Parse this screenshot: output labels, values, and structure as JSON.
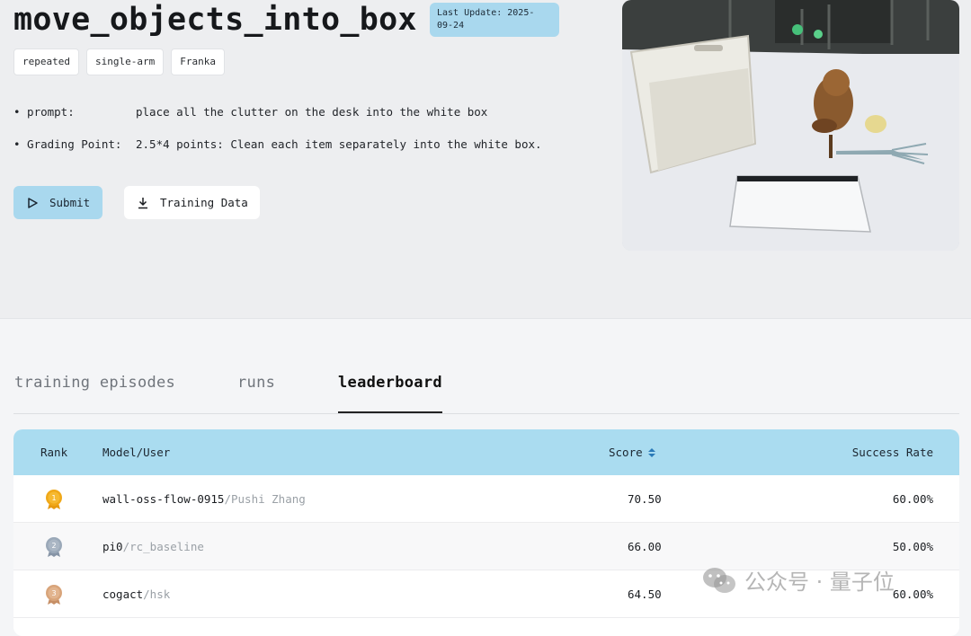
{
  "task": {
    "title": "move_objects_into_box",
    "update_line1": "Last Update: 2025-",
    "update_line2": "09-24",
    "tags": [
      "repeated",
      "single-arm",
      "Franka"
    ],
    "prompt_label": "• prompt:",
    "prompt_value": "place all the clutter on the desk into the white box",
    "grading_label": "• Grading Point:",
    "grading_value": "2.5*4 points: Clean each item separately into the white box."
  },
  "buttons": {
    "submit": "Submit",
    "training_data": "Training Data"
  },
  "tabs": [
    {
      "label": "training episodes",
      "active": false
    },
    {
      "label": "runs",
      "active": false
    },
    {
      "label": "leaderboard",
      "active": true
    }
  ],
  "leaderboard": {
    "columns": {
      "rank": "Rank",
      "model": "Model/User",
      "score": "Score",
      "success": "Success Rate"
    },
    "rows": [
      {
        "rank": "1",
        "model": "wall-oss-flow-0915",
        "user": "/Pushi Zhang",
        "score": "70.50",
        "success": "60.00%",
        "medal_color": "#f0a818"
      },
      {
        "rank": "2",
        "model": "pi0",
        "user": "/rc_baseline",
        "score": "66.00",
        "success": "50.00%",
        "medal_color": "#9aa8b8"
      },
      {
        "rank": "3",
        "model": "cogact",
        "user": "/hsk",
        "score": "64.50",
        "success": "60.00%",
        "medal_color": "#d8a47a"
      }
    ]
  },
  "watermark": "公众号 · 量子位",
  "colors": {
    "accent": "#a9d8ee",
    "table_header": "#aadcf0"
  }
}
